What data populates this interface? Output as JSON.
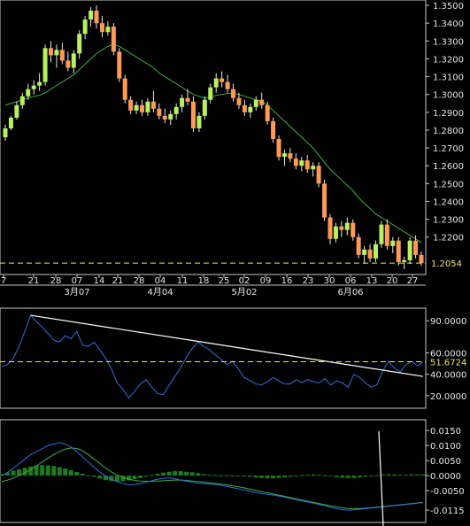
{
  "colors": {
    "background": "#000000",
    "frame": "#c8c8c8",
    "candle_up": "#b8f060",
    "candle_down": "#ff9a55",
    "wick": "#e8e8e8",
    "ma_line": "#3fae3f",
    "price_marker": "#e8e860",
    "rsi_line": "#2f6fd8",
    "trend_line": "#ffffff",
    "macd_line": "#2f6fd8",
    "signal_line": "#3fae3f",
    "histogram": "#1e7a1e",
    "label": "#e6e6e6"
  },
  "price_panel": {
    "y_ticks": [
      "1.3500",
      "1.3400",
      "1.3300",
      "1.3200",
      "1.3100",
      "1.3000",
      "1.2900",
      "1.2800",
      "1.2700",
      "1.2600",
      "1.2500",
      "1.2400",
      "1.2300",
      "1.2200"
    ],
    "y_tick_values": [
      1.35,
      1.34,
      1.33,
      1.32,
      1.31,
      1.3,
      1.29,
      1.28,
      1.27,
      1.26,
      1.25,
      1.24,
      1.23,
      1.22
    ],
    "current_price": "1.2054",
    "current_price_value": 1.2054,
    "day_labels": [
      "7",
      "21",
      "28",
      "07",
      "14",
      "21",
      "28",
      "04",
      "11",
      "18",
      "25",
      "02",
      "09",
      "16",
      "23",
      "30",
      "06",
      "13",
      "20",
      "27"
    ],
    "month_labels": [
      "3月07",
      "4月04",
      "5月02",
      "6月06"
    ]
  },
  "rsi_panel": {
    "y_ticks": [
      "90.0000",
      "60.0000",
      "40.0000",
      "20.0000"
    ],
    "y_tick_values": [
      90,
      60,
      40,
      20
    ],
    "current_value": "51.6724",
    "current_value_num": 51.6724
  },
  "macd_panel": {
    "y_ticks": [
      "0.0150",
      "0.0100",
      "0.0050",
      "0.0000",
      "-0.0050",
      "-0.0115"
    ],
    "y_tick_values": [
      0.015,
      0.01,
      0.005,
      0,
      -0.005,
      -0.0115
    ]
  },
  "chart_data": [
    {
      "type": "candlestick",
      "series": [
        {
          "name": "",
          "values": [
            [
              1.276,
              1.283,
              1.274,
              1.281
            ],
            [
              1.281,
              1.288,
              1.28,
              1.287
            ],
            [
              1.287,
              1.296,
              1.286,
              1.294
            ],
            [
              1.294,
              1.301,
              1.292,
              1.299
            ],
            [
              1.299,
              1.306,
              1.297,
              1.303
            ],
            [
              1.303,
              1.308,
              1.3,
              1.305
            ],
            [
              1.305,
              1.312,
              1.302,
              1.307
            ],
            [
              1.307,
              1.328,
              1.305,
              1.326
            ],
            [
              1.326,
              1.33,
              1.318,
              1.322
            ],
            [
              1.322,
              1.328,
              1.315,
              1.325
            ],
            [
              1.325,
              1.329,
              1.317,
              1.319
            ],
            [
              1.319,
              1.324,
              1.313,
              1.315
            ],
            [
              1.315,
              1.325,
              1.312,
              1.323
            ],
            [
              1.323,
              1.336,
              1.32,
              1.334
            ],
            [
              1.334,
              1.344,
              1.331,
              1.342
            ],
            [
              1.342,
              1.349,
              1.338,
              1.347
            ],
            [
              1.347,
              1.35,
              1.337,
              1.34
            ],
            [
              1.34,
              1.344,
              1.332,
              1.335
            ],
            [
              1.335,
              1.341,
              1.333,
              1.338
            ],
            [
              1.338,
              1.34,
              1.322,
              1.324
            ],
            [
              1.324,
              1.326,
              1.307,
              1.309
            ],
            [
              1.309,
              1.311,
              1.295,
              1.297
            ],
            [
              1.297,
              1.299,
              1.289,
              1.291
            ],
            [
              1.291,
              1.296,
              1.289,
              1.294
            ],
            [
              1.294,
              1.297,
              1.288,
              1.29
            ],
            [
              1.29,
              1.298,
              1.288,
              1.296
            ],
            [
              1.296,
              1.302,
              1.29,
              1.292
            ],
            [
              1.292,
              1.295,
              1.286,
              1.288
            ],
            [
              1.288,
              1.292,
              1.284,
              1.286
            ],
            [
              1.286,
              1.291,
              1.283,
              1.289
            ],
            [
              1.289,
              1.295,
              1.286,
              1.293
            ],
            [
              1.293,
              1.3,
              1.29,
              1.298
            ],
            [
              1.298,
              1.303,
              1.294,
              1.296
            ],
            [
              1.296,
              1.299,
              1.279,
              1.281
            ],
            [
              1.281,
              1.29,
              1.279,
              1.288
            ],
            [
              1.288,
              1.299,
              1.286,
              1.297
            ],
            [
              1.297,
              1.306,
              1.295,
              1.304
            ],
            [
              1.304,
              1.312,
              1.301,
              1.309
            ],
            [
              1.309,
              1.313,
              1.304,
              1.307
            ],
            [
              1.307,
              1.311,
              1.301,
              1.303
            ],
            [
              1.303,
              1.306,
              1.296,
              1.298
            ],
            [
              1.298,
              1.301,
              1.292,
              1.294
            ],
            [
              1.294,
              1.297,
              1.288,
              1.29
            ],
            [
              1.29,
              1.295,
              1.287,
              1.293
            ],
            [
              1.293,
              1.299,
              1.291,
              1.297
            ],
            [
              1.297,
              1.301,
              1.292,
              1.294
            ],
            [
              1.294,
              1.296,
              1.283,
              1.285
            ],
            [
              1.285,
              1.287,
              1.273,
              1.275
            ],
            [
              1.275,
              1.277,
              1.263,
              1.265
            ],
            [
              1.265,
              1.269,
              1.26,
              1.267
            ],
            [
              1.267,
              1.27,
              1.262,
              1.264
            ],
            [
              1.264,
              1.267,
              1.258,
              1.26
            ],
            [
              1.26,
              1.265,
              1.257,
              1.263
            ],
            [
              1.263,
              1.266,
              1.256,
              1.258
            ],
            [
              1.258,
              1.262,
              1.254,
              1.26
            ],
            [
              1.26,
              1.262,
              1.248,
              1.25
            ],
            [
              1.25,
              1.252,
              1.229,
              1.231
            ],
            [
              1.231,
              1.233,
              1.216,
              1.219
            ],
            [
              1.219,
              1.228,
              1.217,
              1.226
            ],
            [
              1.226,
              1.229,
              1.22,
              1.224
            ],
            [
              1.224,
              1.231,
              1.221,
              1.228
            ],
            [
              1.228,
              1.23,
              1.218,
              1.22
            ],
            [
              1.22,
              1.222,
              1.208,
              1.21
            ],
            [
              1.21,
              1.215,
              1.205,
              1.213
            ],
            [
              1.213,
              1.216,
              1.206,
              1.208
            ],
            [
              1.208,
              1.218,
              1.206,
              1.216
            ],
            [
              1.216,
              1.229,
              1.214,
              1.227
            ],
            [
              1.227,
              1.23,
              1.213,
              1.215
            ],
            [
              1.215,
              1.22,
              1.211,
              1.218
            ],
            [
              1.218,
              1.22,
              1.204,
              1.206
            ],
            [
              1.206,
              1.209,
              1.202,
              1.207
            ],
            [
              1.207,
              1.22,
              1.205,
              1.218
            ],
            [
              1.218,
              1.221,
              1.208,
              1.21
            ],
            [
              1.21,
              1.212,
              1.204,
              1.2054
            ]
          ]
        }
      ],
      "ma": [
        1.294,
        1.295,
        1.296,
        1.297,
        1.298,
        1.299,
        1.2995,
        1.301,
        1.303,
        1.305,
        1.307,
        1.309,
        1.311,
        1.314,
        1.317,
        1.32,
        1.323,
        1.325,
        1.327,
        1.328,
        1.327,
        1.325,
        1.323,
        1.321,
        1.319,
        1.317,
        1.315,
        1.312,
        1.31,
        1.308,
        1.306,
        1.304,
        1.302,
        1.3,
        1.299,
        1.298,
        1.2985,
        1.2995,
        1.3,
        1.3005,
        1.3005,
        1.3,
        1.299,
        1.298,
        1.297,
        1.296,
        1.294,
        1.291,
        1.288,
        1.285,
        1.282,
        1.279,
        1.276,
        1.273,
        1.27,
        1.266,
        1.262,
        1.258,
        1.255,
        1.252,
        1.249,
        1.246,
        1.242,
        1.239,
        1.236,
        1.233,
        1.231,
        1.229,
        1.227,
        1.225,
        1.223,
        1.221,
        1.219,
        1.217
      ],
      "ylim": [
        1.2,
        1.352
      ]
    },
    {
      "type": "line",
      "series": [
        {
          "name": "",
          "values": [
            47,
            49,
            55,
            66,
            80,
            95,
            89,
            84,
            78,
            72,
            70,
            76,
            73,
            80,
            67,
            66,
            70,
            63,
            55,
            45,
            32,
            26,
            18,
            24,
            31,
            35,
            28,
            22,
            21,
            30,
            38,
            46,
            56,
            64,
            70,
            66,
            63,
            58,
            54,
            49,
            52,
            45,
            37,
            34,
            31,
            30,
            33,
            37,
            34,
            31,
            31,
            35,
            32,
            35,
            33,
            32,
            36,
            30,
            34,
            32,
            28,
            40,
            37,
            32,
            28,
            30,
            43,
            52,
            46,
            42,
            49,
            52,
            48,
            51.67
          ]
        }
      ],
      "trend_line": {
        "from": 95,
        "to": 38
      },
      "ylim": [
        10,
        100
      ]
    },
    {
      "type": "bar",
      "series": [
        {
          "name": "",
          "values": [
            0.0005,
            0.001,
            0.0016,
            0.0021,
            0.0026,
            0.003,
            0.0034,
            0.0035,
            0.0034,
            0.0032,
            0.0028,
            0.0024,
            0.0018,
            0.0012,
            0.0006,
            0.0001,
            -0.0004,
            -0.001,
            -0.0015,
            -0.0018,
            -0.002,
            -0.0019,
            -0.0016,
            -0.0012,
            -0.0008,
            -0.0003,
            0.0002,
            0.0006,
            0.001,
            0.0013,
            0.0015,
            0.0015,
            0.0013,
            0.0011,
            0.0008,
            0.0005,
            0.0003,
            0.0002,
            0.0001,
            0.0001,
            0.0,
            -0.0001,
            -0.0002,
            -0.0004,
            -0.0006,
            -0.0008,
            -0.0009,
            -0.0009,
            -0.0008,
            -0.0006,
            -0.0004,
            -0.0001,
            0.0002,
            0.0003,
            0.0004,
            0.0003,
            0.0001,
            -0.0002,
            -0.0005,
            -0.0007,
            -0.0008,
            -0.0008,
            -0.0006,
            -0.0004,
            -0.0002,
            0.0001,
            0.0003,
            0.0004,
            0.0004,
            0.0003,
            0.0003,
            0.0004,
            0.0004,
            0.0004
          ]
        },
        {
          "name": "",
          "values": [
            0.0,
            0.001,
            0.0025,
            0.004,
            0.0055,
            0.007,
            0.008,
            0.009,
            0.01,
            0.0105,
            0.011,
            0.0105,
            0.0095,
            0.008,
            0.0062,
            0.0045,
            0.0028,
            0.0012,
            -0.0002,
            -0.0012,
            -0.002,
            -0.0026,
            -0.003,
            -0.003,
            -0.0027,
            -0.0022,
            -0.0017,
            -0.0012,
            -0.0009,
            -0.0008,
            -0.001,
            -0.0015,
            -0.0018,
            -0.0022,
            -0.0025,
            -0.0027,
            -0.0028,
            -0.003,
            -0.0032,
            -0.0036,
            -0.004,
            -0.0044,
            -0.0048,
            -0.0052,
            -0.0056,
            -0.006,
            -0.0062,
            -0.0065,
            -0.0068,
            -0.0072,
            -0.0076,
            -0.008,
            -0.0084,
            -0.0088,
            -0.0092,
            -0.0096,
            -0.01,
            -0.0106,
            -0.011,
            -0.0113,
            -0.0115,
            -0.0114,
            -0.0112,
            -0.011,
            -0.0108,
            -0.0106,
            -0.0104,
            -0.0102,
            -0.01,
            -0.0098,
            -0.0096,
            -0.0094,
            -0.0092,
            -0.009
          ]
        },
        {
          "name": "",
          "values": [
            -0.002,
            -0.0015,
            -0.0008,
            0.0,
            0.001,
            0.002,
            0.0032,
            0.0045,
            0.0058,
            0.007,
            0.008,
            0.0088,
            0.0092,
            0.009,
            0.0083,
            0.007,
            0.0055,
            0.004,
            0.0025,
            0.0012,
            0.0002,
            -0.0006,
            -0.0012,
            -0.0016,
            -0.0018,
            -0.0019,
            -0.0019,
            -0.0018,
            -0.0017,
            -0.0016,
            -0.0015,
            -0.0015,
            -0.0016,
            -0.0018,
            -0.002,
            -0.0022,
            -0.0024,
            -0.0026,
            -0.0028,
            -0.0031,
            -0.0034,
            -0.0037,
            -0.0041,
            -0.0045,
            -0.0049,
            -0.0053,
            -0.0057,
            -0.0061,
            -0.0065,
            -0.0069,
            -0.0073,
            -0.0077,
            -0.0081,
            -0.0085,
            -0.0089,
            -0.0093,
            -0.0097,
            -0.0101,
            -0.0104,
            -0.0107,
            -0.011,
            -0.011,
            -0.011,
            -0.0108,
            -0.0107,
            -0.0105,
            -0.0103,
            -0.0101,
            -0.0099,
            -0.0097,
            -0.0095,
            -0.0093,
            -0.0091,
            -0.0089
          ]
        }
      ],
      "ylim": [
        -0.015,
        0.018
      ]
    }
  ]
}
